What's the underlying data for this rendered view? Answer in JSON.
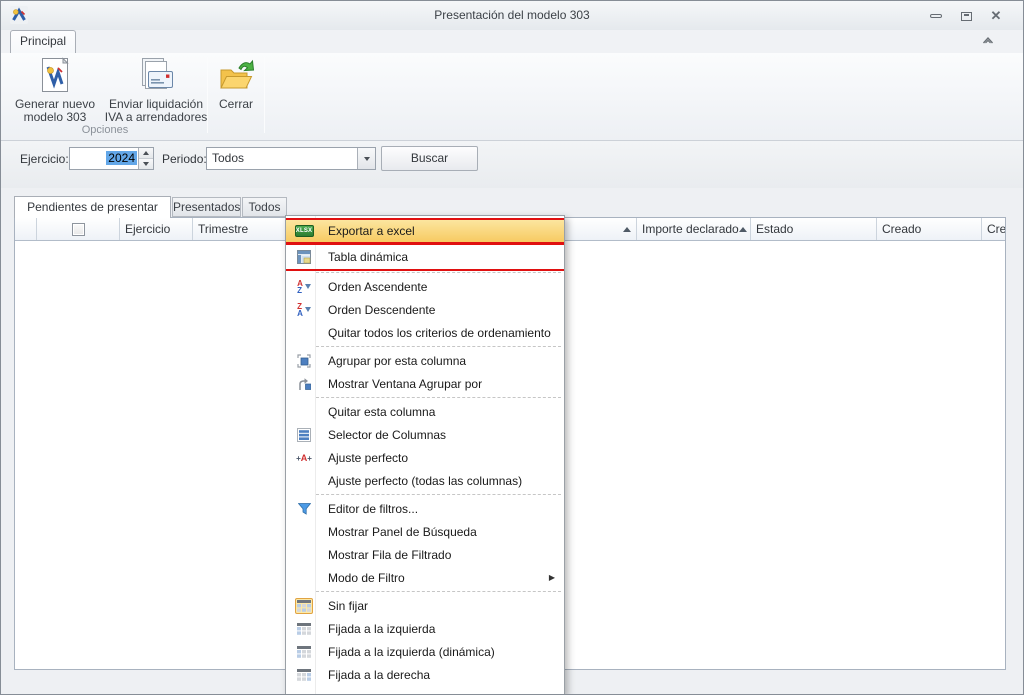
{
  "window": {
    "title": "Presentación del modelo 303"
  },
  "icons": {
    "close_glyph": "✕",
    "submenu_arrow": "▶",
    "sort_ascending_glyph": "▲"
  },
  "colors": {
    "annotation_red": "#e01010",
    "menu_highlight_orange": "#f7c95f",
    "selection_blue": "#63a7e8",
    "xlsx_green": "#3a9140"
  },
  "ribbon": {
    "tab": "Principal",
    "group_label": "Opciones",
    "buttons": {
      "generar": "Generar nuevo modelo 303",
      "enviar": "Enviar liquidación IVA a arrendadores",
      "cerrar": "Cerrar"
    }
  },
  "filter_bar": {
    "ejercicio_label": "Ejercicio:",
    "ejercicio_value": "2024",
    "periodo_label": "Periodo:",
    "periodo_value": "Todos",
    "buscar": "Buscar"
  },
  "view_tabs": {
    "pendientes": "Pendientes de presentar",
    "presentados": "Presentados",
    "todos": "Todos"
  },
  "grid": {
    "columns": {
      "ejercicio": "Ejercicio",
      "trimestre": "Trimestre",
      "importe": "Importe declarado",
      "estado": "Estado",
      "creado": "Creado",
      "creado_clipped": "Cre"
    }
  },
  "menu": {
    "items": [
      {
        "label": "Exportar a excel",
        "icon": "xlsx",
        "highlight": true,
        "annotated": true
      },
      {
        "label": "Tabla dinámica",
        "icon": "pivot",
        "annotated": true
      },
      {
        "sep": true
      },
      {
        "label": "Orden Ascendente",
        "icon": "sort-az"
      },
      {
        "label": "Orden Descendente",
        "icon": "sort-za"
      },
      {
        "label": "Quitar todos los criterios de ordenamiento"
      },
      {
        "sep": true
      },
      {
        "label": "Agrupar por esta columna",
        "icon": "group"
      },
      {
        "label": "Mostrar Ventana Agrupar por",
        "icon": "group-window"
      },
      {
        "sep": true
      },
      {
        "label": "Quitar esta columna"
      },
      {
        "label": "Selector de Columnas",
        "icon": "columns"
      },
      {
        "label": "Ajuste perfecto",
        "icon": "bestfit"
      },
      {
        "label": "Ajuste perfecto (todas las columnas)"
      },
      {
        "sep": true
      },
      {
        "label": "Editor de filtros...",
        "icon": "filter"
      },
      {
        "label": "Mostrar Panel de Búsqueda"
      },
      {
        "label": "Mostrar Fila de Filtrado"
      },
      {
        "label": "Modo de Filtro",
        "submenu": true
      },
      {
        "sep": true
      },
      {
        "label": "Sin fijar",
        "icon": "pin-none"
      },
      {
        "label": "Fijada a la izquierda",
        "icon": "pin-left"
      },
      {
        "label": "Fijada a la izquierda (dinámica)",
        "icon": "pin-left"
      },
      {
        "label": "Fijada a la derecha",
        "icon": "pin-right"
      }
    ]
  }
}
